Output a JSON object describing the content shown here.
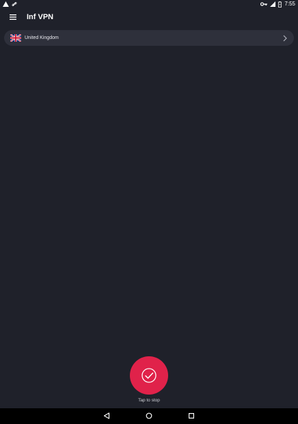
{
  "status_bar": {
    "time": "7:55",
    "left_icons": [
      "warning-icon",
      "link-icon"
    ],
    "right_icons": [
      "vpn-key-icon",
      "signal-icon",
      "battery-icon"
    ]
  },
  "app_bar": {
    "title": "Inf VPN",
    "menu_icon": "hamburger-menu-icon"
  },
  "location": {
    "country": "United Kingdom",
    "flag_icon": "uk-flag-icon",
    "chevron_icon": "chevron-right-icon"
  },
  "connection": {
    "status_text": "Tap to stop",
    "button_icon": "check-circle-icon",
    "accent_color": "#e0224a"
  },
  "nav_bar": {
    "icons": [
      "back-icon",
      "home-icon",
      "recents-icon"
    ]
  },
  "colors": {
    "background": "#1f212a",
    "panel": "#2e303b"
  }
}
